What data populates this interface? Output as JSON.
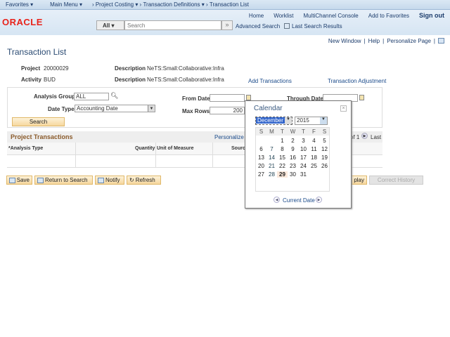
{
  "nav": {
    "favorites": "Favorites ▾",
    "main_menu": "Main Menu ▾",
    "crumbs": [
      "Project Costing ▾",
      "Transaction Definitions ▾",
      "Transaction List"
    ]
  },
  "header": {
    "logo": "ORACLE",
    "links": [
      "Home",
      "Worklist",
      "MultiChannel Console",
      "Add to Favorites"
    ],
    "sign_out": "Sign out",
    "search_scope": "All",
    "search_placeholder": "Search",
    "advanced_search": "Advanced Search",
    "last_search": "Last Search Results"
  },
  "pagebar": {
    "new_window": "New Window",
    "help": "Help",
    "personalize": "Personalize Page"
  },
  "page": {
    "title": "Transaction List",
    "project_label": "Project",
    "project": "20000029",
    "activity_label": "Activity",
    "activity": "BUD",
    "desc_label": "Description",
    "project_desc": "NeTS:Small:Collaborative:Infra",
    "activity_desc": "NeTS:Small:Collaborative:Infra",
    "add_transactions": "Add Transactions",
    "transaction_adjustment": "Transaction Adjustment"
  },
  "criteria": {
    "analysis_group_label": "Analysis Group",
    "analysis_group": "ALL",
    "date_type_label": "Date Type",
    "date_type": "Accounting Date",
    "from_date_label": "From Date",
    "from_date": "",
    "through_date_label": "Through Date",
    "through_date": "",
    "max_rows_label": "Max Rows",
    "max_rows": "200",
    "search": "Search"
  },
  "grid": {
    "title": "Project Transactions",
    "personalize": "Personalize",
    "pager": "of 1",
    "last": "Last",
    "columns": [
      "*Analysis Type",
      "Quantity",
      "Unit of Measure",
      "Source"
    ]
  },
  "buttons": {
    "save": "Save",
    "return": "Return to Search",
    "notify": "Notify",
    "refresh": "Refresh",
    "display": "play",
    "correct_history": "Correct History"
  },
  "calendar": {
    "title": "Calendar",
    "month": "December",
    "year": "2015",
    "weekdays": [
      "S",
      "M",
      "T",
      "W",
      "T",
      "F",
      "S"
    ],
    "weeks": [
      [
        "",
        "",
        "1",
        "2",
        "3",
        "4",
        "5"
      ],
      [
        "6",
        "7",
        "8",
        "9",
        "10",
        "11",
        "12"
      ],
      [
        "13",
        "14",
        "15",
        "16",
        "17",
        "18",
        "19"
      ],
      [
        "20",
        "21",
        "22",
        "23",
        "24",
        "25",
        "26"
      ],
      [
        "27",
        "28",
        "29",
        "30",
        "31",
        "",
        ""
      ]
    ],
    "today": "29",
    "current_date": "Current Date"
  }
}
